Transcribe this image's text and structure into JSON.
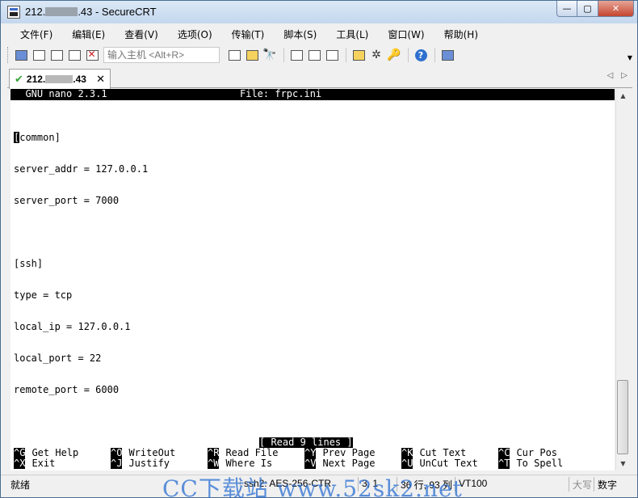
{
  "window": {
    "title_prefix": "212.",
    "title_suffix": ".43 - SecureCRT",
    "caption": {
      "min": "—",
      "max": "▢",
      "close": "✕"
    }
  },
  "menu": [
    {
      "id": "file",
      "label": "文件(F)"
    },
    {
      "id": "edit",
      "label": "编辑(E)"
    },
    {
      "id": "view",
      "label": "查看(V)"
    },
    {
      "id": "options",
      "label": "选项(O)"
    },
    {
      "id": "transfer",
      "label": "传输(T)"
    },
    {
      "id": "script",
      "label": "脚本(S)"
    },
    {
      "id": "tools",
      "label": "工具(L)"
    },
    {
      "id": "window",
      "label": "窗口(W)"
    },
    {
      "id": "help",
      "label": "帮助(H)"
    }
  ],
  "toolbar": {
    "command_placeholder": "输入主机 <Alt+R>"
  },
  "tab": {
    "label_prefix": "212.",
    "label_suffix": ".43",
    "close": "✕",
    "nav_left": "◁",
    "nav_right": "▷"
  },
  "terminal": {
    "header_left": "  GNU nano 2.3.1",
    "header_right": "File: frpc.ini",
    "cursor_char": "[",
    "first_line_rest": "common]",
    "lines": [
      "server_addr = 127.0.0.1",
      "server_port = 7000",
      "",
      "[ssh]",
      "type = tcp",
      "local_ip = 127.0.0.1",
      "local_port = 22",
      "remote_port = 6000"
    ],
    "status": "[ Read 9 lines ]",
    "shortcuts_row1": [
      {
        "key": "^G",
        "label": "Get Help"
      },
      {
        "key": "^O",
        "label": "WriteOut"
      },
      {
        "key": "^R",
        "label": "Read File"
      },
      {
        "key": "^Y",
        "label": "Prev Page"
      },
      {
        "key": "^K",
        "label": "Cut Text"
      },
      {
        "key": "^C",
        "label": "Cur Pos"
      }
    ],
    "shortcuts_row2": [
      {
        "key": "^X",
        "label": "Exit"
      },
      {
        "key": "^J",
        "label": "Justify"
      },
      {
        "key": "^W",
        "label": "Where Is"
      },
      {
        "key": "^V",
        "label": "Next Page"
      },
      {
        "key": "^U",
        "label": "UnCut Text"
      },
      {
        "key": "^T",
        "label": "To Spell"
      }
    ]
  },
  "statusbar": {
    "ready": "就绪",
    "protocol": "ssh2: AES-256-CTR",
    "cursor_pos": "3,  1",
    "size": "36 行, 93 列",
    "term": "VT100",
    "caps": "大写",
    "num": "数字"
  },
  "watermark": "CC下载站 www.52sk2.net"
}
